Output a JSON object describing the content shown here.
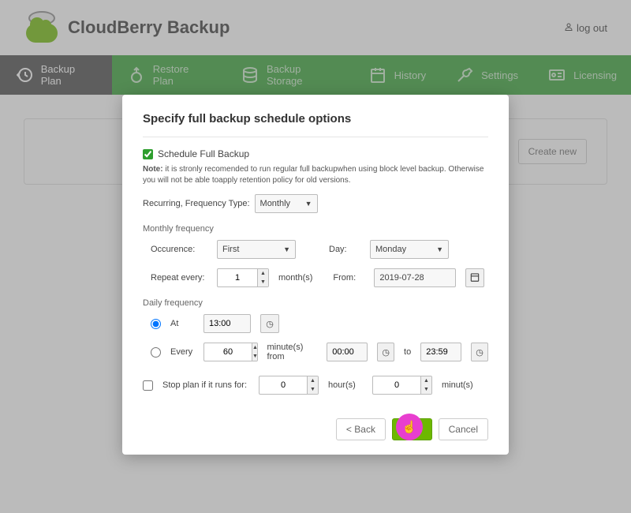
{
  "brand": {
    "title": "CloudBerry Backup"
  },
  "header": {
    "logout": "log out"
  },
  "nav": {
    "items": [
      {
        "label": "Backup Plan"
      },
      {
        "label": "Restore Plan"
      },
      {
        "label": "Backup Storage"
      },
      {
        "label": "History"
      },
      {
        "label": "Settings"
      },
      {
        "label": "Licensing"
      }
    ]
  },
  "card": {
    "create": "Create new"
  },
  "modal": {
    "title": "Specify full backup schedule options",
    "schedule_check": "Schedule Full Backup",
    "note_prefix": "Note:",
    "note_text": " it is stronly recomended to run regular full backupwhen using block level backup. Otherwise you will not be able toapply retention policy for old versions.",
    "freq_label": "Recurring, Frequency Type:",
    "freq_value": "Monthly",
    "section_monthly": "Monthly frequency",
    "occurence_label": "Occurence:",
    "occurence_value": "First",
    "day_label": "Day:",
    "day_value": "Monday",
    "repeat_label": "Repeat every:",
    "repeat_value": "1",
    "repeat_unit": "month(s)",
    "from_label": "From:",
    "from_value": "2019-07-28",
    "section_daily": "Daily frequency",
    "at_label": "At",
    "at_value": "13:00",
    "every_label": "Every",
    "every_value": "60",
    "every_unit": "minute(s) from",
    "range_from": "00:00",
    "range_to_label": "to",
    "range_to": "23:59",
    "stop_label": "Stop plan if it runs for:",
    "stop_hours": "0",
    "stop_hours_unit": "hour(s)",
    "stop_min": "0",
    "stop_min_unit": "minut(s)",
    "back": "< Back",
    "next": "Next",
    "cancel": "Cancel"
  }
}
